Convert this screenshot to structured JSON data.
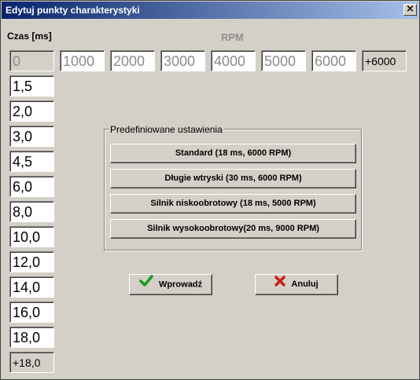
{
  "window": {
    "title": "Edytuj punkty charakterystyki",
    "close_label": "×"
  },
  "labels": {
    "time": "Czas [ms]",
    "rpm": "RPM"
  },
  "rpm_fields": [
    "0",
    "1000",
    "2000",
    "3000",
    "4000",
    "5000",
    "6000",
    "+6000"
  ],
  "time_fields": [
    "1,5",
    "2,0",
    "3,0",
    "4,5",
    "6,0",
    "8,0",
    "10,0",
    "12,0",
    "14,0",
    "16,0",
    "18,0",
    "+18,0"
  ],
  "presets": {
    "title": "Predefiniowane ustawienia",
    "buttons": [
      "Standard (18 ms, 6000 RPM)",
      "Długie wtryski (30 ms, 6000 RPM)",
      "Silnik niskoobrotowy  (18 ms, 5000 RPM)",
      "Silnik wysokoobrotowy(20 ms, 9000 RPM)"
    ]
  },
  "actions": {
    "ok_label": "Wprowadź",
    "cancel_label": "Anuluj"
  },
  "colors": {
    "titlebar_start": "#08246b",
    "titlebar_end": "#a5c0e8",
    "ok_icon": "#1a9a1a",
    "cancel_icon": "#c81e1e"
  },
  "icons": {
    "ok": "checkmark-icon",
    "cancel": "x-icon",
    "close": "close-icon"
  }
}
